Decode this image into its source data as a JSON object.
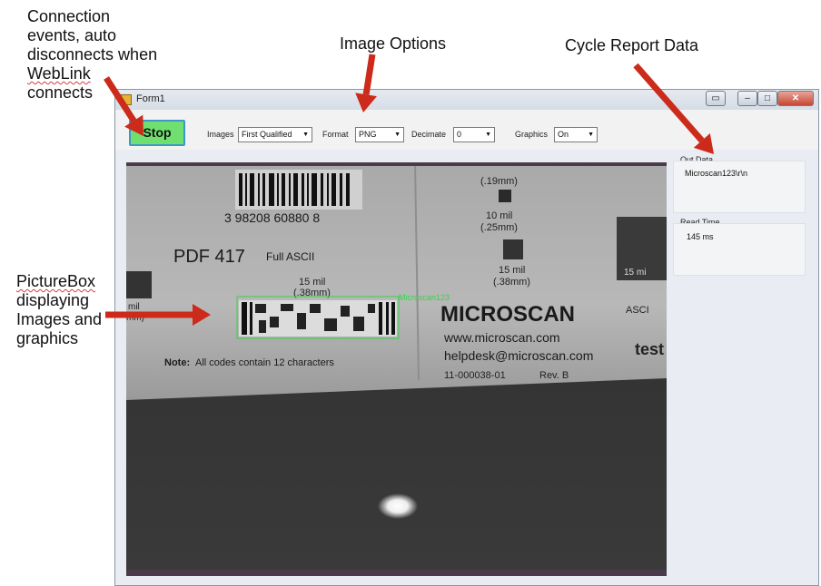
{
  "annotations": {
    "connection_lines": [
      "Connection",
      "events, auto",
      "disconnects when",
      "WebLink",
      "connects"
    ],
    "image_options": "Image Options",
    "cycle_report": "Cycle Report Data",
    "picturebox_lines": [
      "PictureBox",
      "displaying",
      "Images and",
      "graphics"
    ],
    "arrow_color": "#cc2a1a"
  },
  "window": {
    "title": "Form1",
    "controls": {
      "restore": "▭",
      "minimize": "–",
      "maximize": "□",
      "close": "✕"
    }
  },
  "toolbar": {
    "stop_label": "Stop",
    "images_label": "Images",
    "images_value": "First Qualified",
    "format_label": "Format",
    "format_value": "PNG",
    "decimate_label": "Decimate",
    "decimate_value": "0",
    "graphics_label": "Graphics",
    "graphics_value": "On"
  },
  "picture": {
    "label_lines": [
      "PDF 417",
      "Full ASCII"
    ],
    "code_size_left": [
      "15 mil",
      "(.38mm)"
    ],
    "barcode_digits": "3  98208  60880  8",
    "sizes_right": [
      "(.19mm)",
      "10 mil",
      "(.25mm)",
      "15 mil",
      "(.38mm)"
    ],
    "overlay_text": "Microscan123",
    "overlay_color": "#3ad24a",
    "brand": "MICROSCAN",
    "website": "www.microscan.com",
    "email": "helpdesk@microscan.com",
    "part_number": "11-000038-01",
    "revision": "Rev. B",
    "note_label": "Note:",
    "note_text": "All codes contain 12 characters",
    "left_edge_text": [
      "mil",
      "mm)"
    ],
    "right_edge_text": [
      "15 mi",
      "ASCI",
      "test"
    ]
  },
  "panels": {
    "out_data_label": "Out Data",
    "out_data_value": "Microscan123\\r\\n",
    "read_time_label": "Read Time",
    "read_time_value": "145 ms"
  }
}
